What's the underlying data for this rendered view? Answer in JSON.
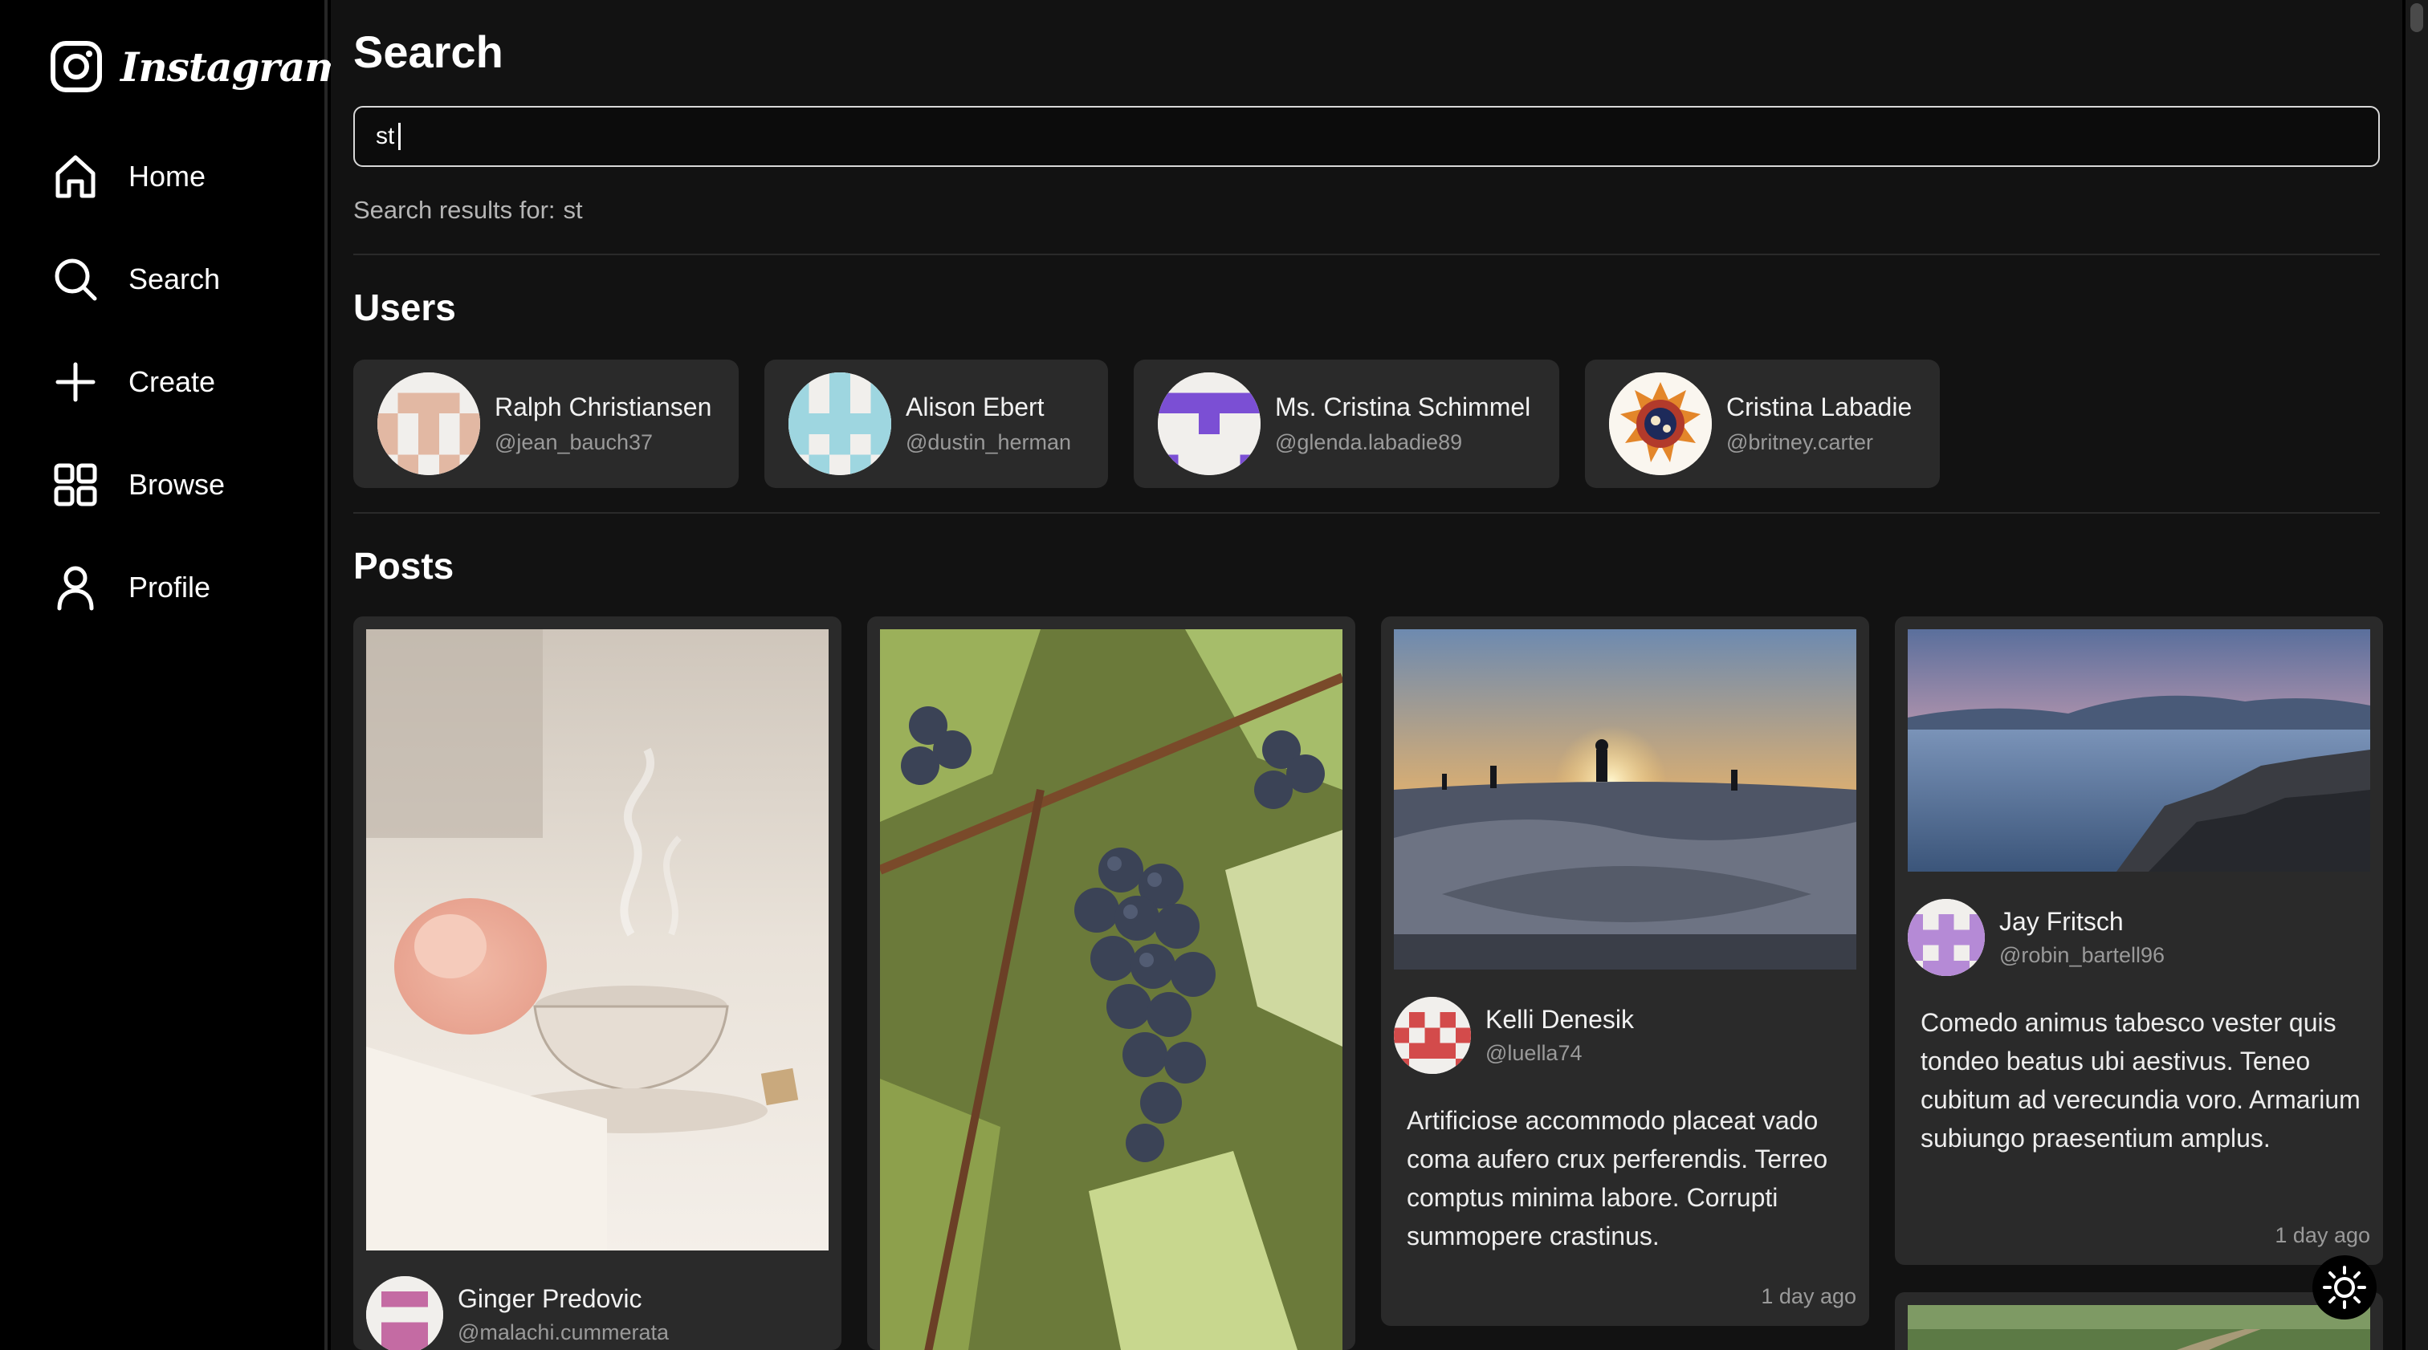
{
  "app": {
    "logo_text": "Instagram"
  },
  "sidebar": {
    "items": [
      {
        "label": "Home",
        "icon": "home-icon"
      },
      {
        "label": "Search",
        "icon": "search-icon"
      },
      {
        "label": "Create",
        "icon": "plus-icon"
      },
      {
        "label": "Browse",
        "icon": "grid-icon"
      },
      {
        "label": "Profile",
        "icon": "user-icon"
      }
    ]
  },
  "search": {
    "title": "Search",
    "query": "st",
    "results_label": "Search results for:",
    "results_query": "st"
  },
  "users_section": {
    "title": "Users",
    "users": [
      {
        "name": "Ralph Christiansen",
        "handle": "@jean_bauch37"
      },
      {
        "name": "Alison Ebert",
        "handle": "@dustin_herman"
      },
      {
        "name": "Ms. Cristina Schimmel",
        "handle": "@glenda.labadie89"
      },
      {
        "name": "Cristina Labadie",
        "handle": "@britney.carter"
      }
    ]
  },
  "posts_section": {
    "title": "Posts",
    "posts": [
      {
        "image": "steaming teacup with pink flower",
        "author": "Ginger Predovic",
        "handle": "@malachi.cummerata"
      },
      {
        "image": "grapes on the vine"
      },
      {
        "image": "skatepark at sunset",
        "author": "Kelli Denesik",
        "handle": "@luella74",
        "text": "Artificiose accommodo placeat vado coma aufero crux perferendis. Terreo comptus minima labore. Corrupti summopere crastinus.",
        "time": "1 day ago"
      },
      {
        "image": "rocky coastline at dusk",
        "author": "Jay Fritsch",
        "handle": "@robin_bartell96",
        "text": "Comedo animus tabesco vester quis tondeo beatus ubi aestivus. Teneo cubitum ad verecundia voro. Armarium subiungo praesentium amplus.",
        "time": "1 day ago"
      },
      {
        "image": "green field trail"
      }
    ]
  },
  "theme_toggle": {
    "icon": "sun-icon"
  },
  "colors": {
    "background": "#000000",
    "main": "#121212",
    "card": "#2a2a2a",
    "muted": "#9a9a9a"
  }
}
